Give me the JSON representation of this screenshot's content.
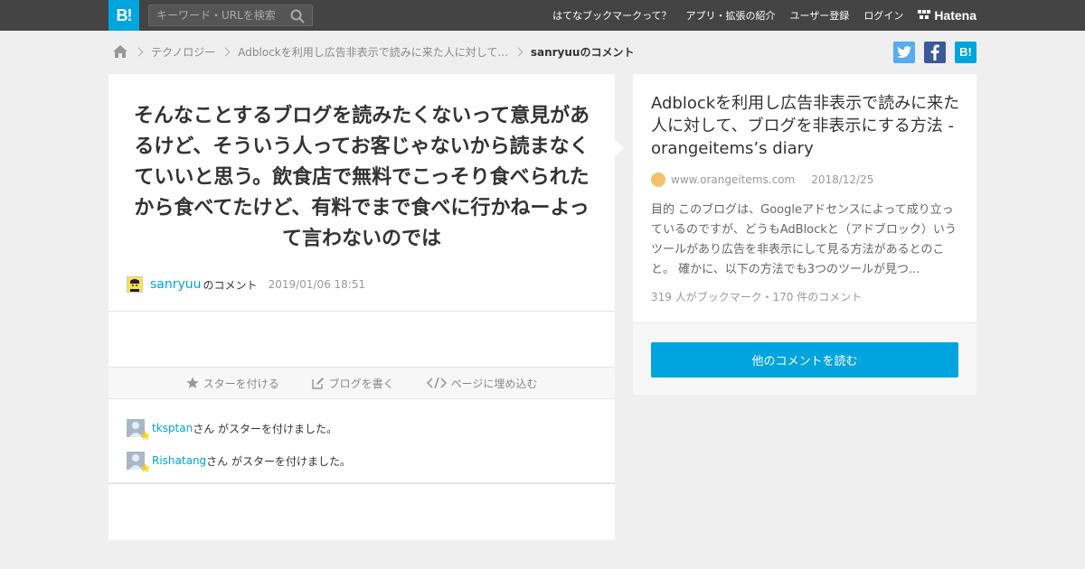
{
  "header": {
    "logo": "B!",
    "search_placeholder": "キーワード・URLを検索",
    "nav": [
      "はてなブックマークって？",
      "アプリ・拡張の紹介",
      "ユーザー登録",
      "ログイン"
    ],
    "brand": "Hatena"
  },
  "breadcrumb": {
    "items": [
      "テクノロジー",
      "Adblockを利用し広告非表示で読みに来た人に対して..."
    ],
    "current": "sanryuuのコメント"
  },
  "share": {
    "twitter": "t",
    "facebook": "f",
    "hatena": "B!"
  },
  "comment": {
    "text": "そんなことするブログを読みたくないって意見があるけど、そういう人ってお客じゃないから読まなくていいと思う。飲食店で無料でこっそり食べられたから食べてたけど、有料でまで食べに行かねーよって言わないのでは",
    "author": "sanryuu",
    "author_suffix": "のコメント",
    "date": "2019/01/06 18:51"
  },
  "actions": {
    "star": "スターを付ける",
    "blog": "ブログを書く",
    "embed": "ページに埋め込む"
  },
  "stars": [
    {
      "user": "tksptan",
      "text": "さん がスターを付けました。"
    },
    {
      "user": "Rishatang",
      "text": "さん がスターを付けました。"
    }
  ],
  "entry": {
    "title": "Adblockを利用し広告非表示で読みに来た人に対して、ブログを非表示にする方法 - orangeitems’s diary",
    "domain": "www.orangeitems.com",
    "date": "2018/12/25",
    "description": "目的 このブログは、Googleアドセンスによって成り立っているのですが、どうもAdBlockと（アドブロック）いうツールがあり広告を非表示にして見る方法があるとのこと。 確かに、以下の方法でも3つのツールが見つ...",
    "count": "319 人がブックマーク・170 件のコメント",
    "button": "他のコメントを読む"
  },
  "colors": {
    "accent": "#00a4de",
    "topbar": "#444444",
    "twitter": "#55acee",
    "facebook": "#3b5998",
    "star": "#ffd700"
  }
}
